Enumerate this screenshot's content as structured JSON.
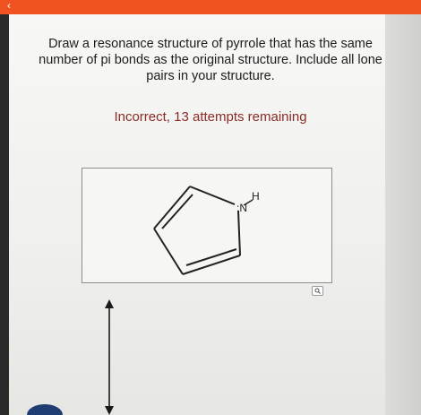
{
  "header": {
    "accent_color": "#f0531f",
    "back_icon": "chevron-left-icon"
  },
  "question": {
    "text": "Draw a resonance structure of pyrrole that has the same number of pi bonds as the original structure. Include all lone pairs in your structure."
  },
  "feedback": {
    "text": "Incorrect, 13 attempts remaining",
    "color": "#8a2c26"
  },
  "drawing_canvas": {
    "atom_n_label": "N",
    "lone_pair_marker": ":",
    "atom_h_label": "H",
    "zoom_icon": "magnifier-icon"
  },
  "tools": {
    "arrow_icon": "double-headed-arrow-icon"
  }
}
